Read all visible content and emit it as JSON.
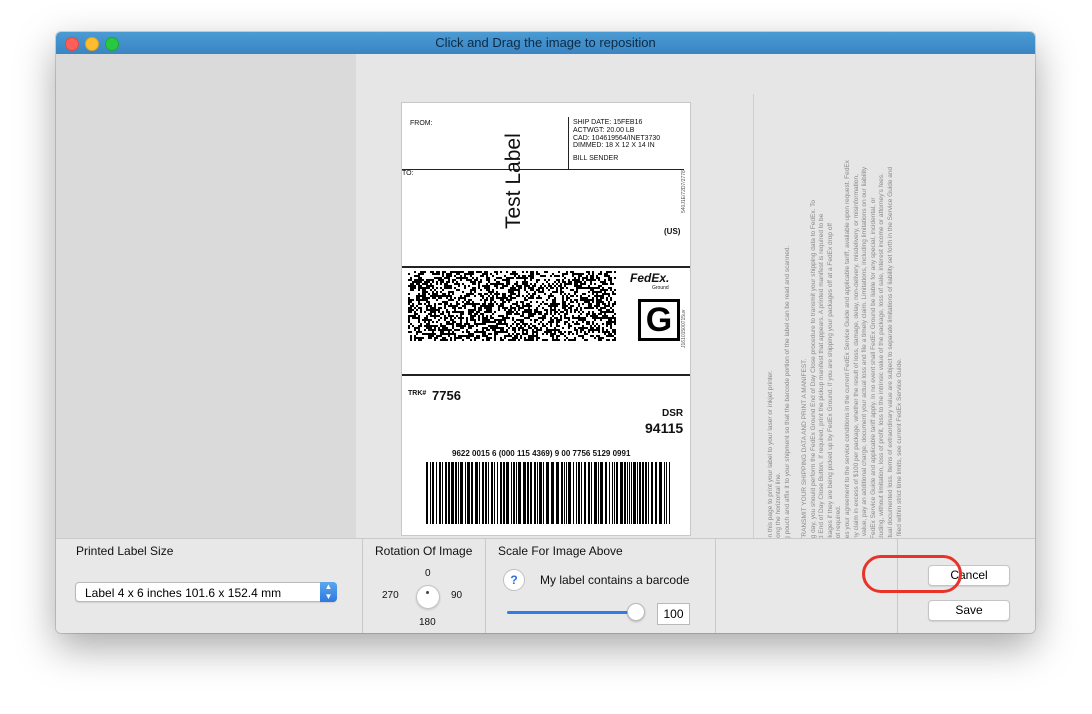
{
  "window": {
    "title": "Click and Drag the image to reposition"
  },
  "label": {
    "from": "FROM:",
    "ship_date": "SHIP DATE: 15FEB16",
    "actwgt": "ACTWGT: 20.00 LB",
    "cad": "CAD: 104619564/INET3730",
    "dimmed": "DIMMED: 18 X 12 X 14 IN",
    "bill": "BILL SENDER",
    "to": "TO:",
    "watermark": "Test Label",
    "country": "(US)",
    "carrier_logo": "FedEx.",
    "carrier_sub": "Ground",
    "service_letter": "G",
    "trk_label": "TRK#",
    "trk_number": "7756",
    "dsr": "DSR",
    "zip": "94115",
    "barcode_text": "9622 0015 6 (000 115 4369) 9 00 7756 5129 0991",
    "side_code_1": "540J1E/72D7/2778",
    "side_code_2": "J16101500715uv"
  },
  "instructions": [
    "abel.",
    "ton on this page to print your label to your laser or inkjet printer.",
    "ge along the horizontal line.",
    "pping pouch and affix it to your shipment so that the barcode portion of the label can be read and scanned.",
    "",
    "NT: TRANSMIT YOUR SHIPPING DATA AND PRINT A MANIFEST.",
    "ipping day, you should perform the FedEx Ground End of Day Close procedure to transmit your shipping data to FedEx. To",
    "round End of Day Close Button. If required, print the pickup manifest that appears. A printed manifest is required to be",
    "r packages if they are being picked up by FedEx Ground. If you are shipping your packages off at a FedEx drop off",
    "t is not required.",
    "stitutes your agreement to the service conditions in the current FedEx Service Guide and applicable tariff, available upon request. FedEx",
    "for any claim in excess of $100 per package, whether the result of loss, damage, delay, non-delivery, misdelivery, or misinformation,",
    "icher value, pay an additional charge, document your actual loss and file a timely claim. Limitations, including limitations on our liability",
    "rent FedEx Service Guide and applicable tariff apply. In no event shall FedEx Ground be liable for any special, incidental, or",
    "s, including, without limitation, loss of profit, loss to the intrinsic value of the package, loss of sale, interest income or attorney's fees.",
    "er actual documented loss. Items of extraordinary value are subject to separate limitations of liability set forth in the Service Guide and",
    "st be filed within strict time limits, see current FedEx Service Guide."
  ],
  "panel": {
    "size_title": "Printed Label Size",
    "size_selected": "Label 4 x 6 inches 101.6 x 152.4 mm",
    "rotation_title": "Rotation Of Image",
    "rot_0": "0",
    "rot_90": "90",
    "rot_180": "180",
    "rot_270": "270",
    "scale_title": "Scale For Image Above",
    "help": "?",
    "barcode_option": "My label contains a barcode",
    "scale_value": "100",
    "scale_fraction": 1.0,
    "cancel": "Cancel",
    "save": "Save"
  },
  "colors": {
    "titlebar": "#3f8fcc",
    "accent": "#2f7ee6",
    "highlight": "#e8322a"
  }
}
